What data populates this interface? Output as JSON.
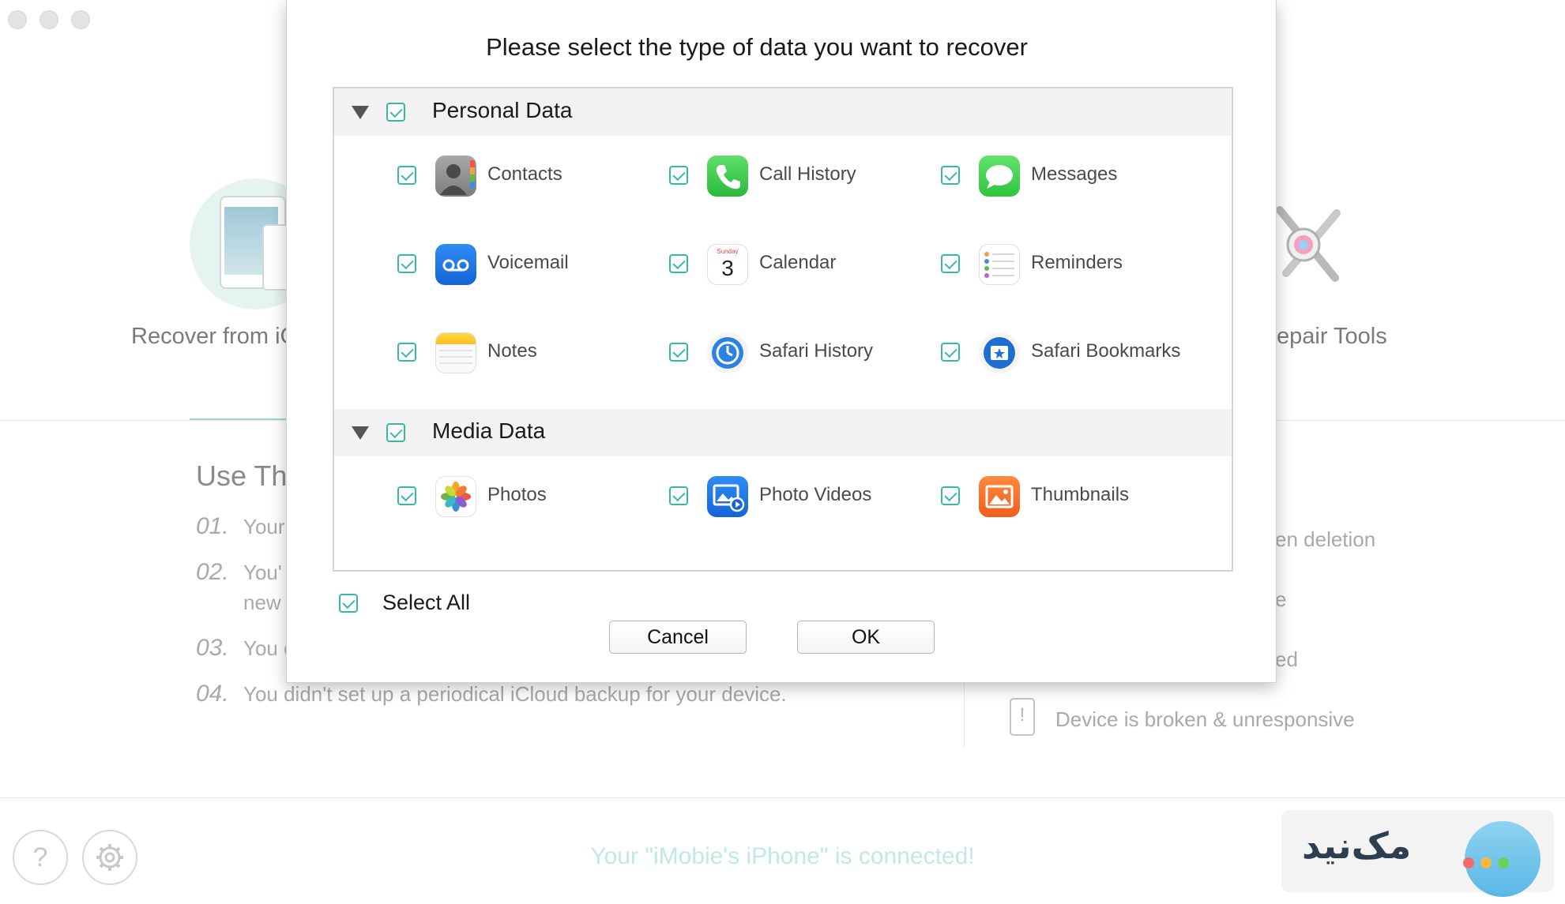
{
  "window": {
    "buttons": [
      "close",
      "minimize",
      "zoom"
    ]
  },
  "background": {
    "left_card_label": "Recover from iC",
    "right_card_label": "epair Tools",
    "section_title": "Use Thi",
    "steps": [
      {
        "num": "01.",
        "text": "Your"
      },
      {
        "num": "02.",
        "text": "You'",
        "text2": "new"
      },
      {
        "num": "03.",
        "text": "You c"
      },
      {
        "num": "04.",
        "text": "You didn't set up a periodical iCloud backup for your device."
      }
    ],
    "right_items": [
      {
        "text": "en deletion"
      },
      {
        "text": "e"
      },
      {
        "text": "ed"
      },
      {
        "text": "Device is broken & unresponsive"
      }
    ]
  },
  "dialog": {
    "title": "Please select the type of data you want to recover",
    "sections": [
      {
        "label": "Personal Data",
        "checked": true,
        "items": [
          {
            "label": "Contacts",
            "icon": "contacts-icon",
            "checked": true
          },
          {
            "label": "Call History",
            "icon": "phone-icon",
            "checked": true
          },
          {
            "label": "Messages",
            "icon": "messages-icon",
            "checked": true
          },
          {
            "label": "Voicemail",
            "icon": "voicemail-icon",
            "checked": true
          },
          {
            "label": "Calendar",
            "icon": "calendar-icon",
            "checked": true
          },
          {
            "label": "Reminders",
            "icon": "reminders-icon",
            "checked": true
          },
          {
            "label": "Notes",
            "icon": "notes-icon",
            "checked": true
          },
          {
            "label": "Safari History",
            "icon": "safari-history-icon",
            "checked": true
          },
          {
            "label": "Safari Bookmarks",
            "icon": "safari-bookmarks-icon",
            "checked": true
          }
        ]
      },
      {
        "label": "Media Data",
        "checked": true,
        "items": [
          {
            "label": "Photos",
            "icon": "photos-icon",
            "checked": true
          },
          {
            "label": "Photo Videos",
            "icon": "photo-videos-icon",
            "checked": true
          },
          {
            "label": "Thumbnails",
            "icon": "thumbnails-icon",
            "checked": true
          }
        ]
      }
    ],
    "calendar_icon": {
      "day": "Sunday",
      "date": "3"
    },
    "select_all_label": "Select All",
    "select_all_checked": true,
    "cancel_label": "Cancel",
    "ok_label": "OK"
  },
  "footer": {
    "help_glyph": "?",
    "status": "Your \"iMobie's iPhone\" is connected!",
    "watermark_text": "مک‌نید"
  },
  "colors": {
    "accent": "#35b9a7",
    "status_text": "#bfe9e2"
  }
}
